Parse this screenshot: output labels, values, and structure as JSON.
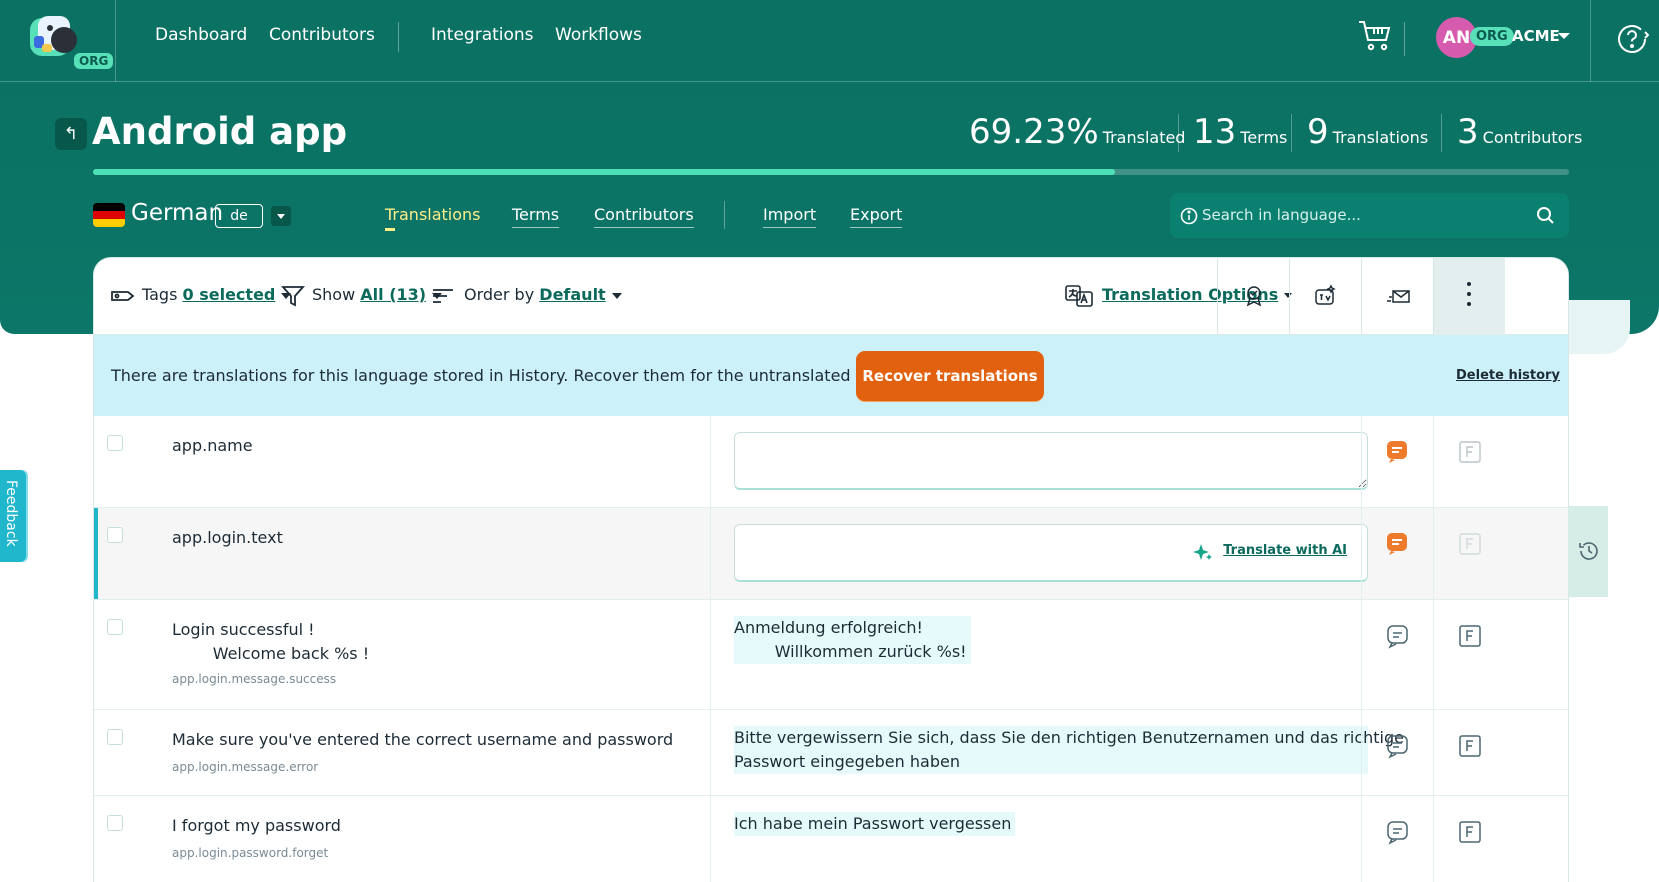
{
  "nav": {
    "org_badge": "ORG",
    "links": [
      "Dashboard",
      "Contributors",
      "Integrations",
      "Workflows"
    ],
    "user_initials": "AN",
    "org_pill": "ORG",
    "org_name": "ACME"
  },
  "project": {
    "title": "Android app",
    "stats": {
      "translated_value": "69.23%",
      "translated_label": "Translated",
      "terms_value": "13",
      "terms_label": "Terms",
      "translations_value": "9",
      "translations_label": "Translations",
      "contributors_value": "3",
      "contributors_label": "Contributors"
    },
    "progress_fraction": 0.6923
  },
  "language": {
    "name": "German",
    "code": "de",
    "flag_colors": [
      "#000000",
      "#dd0000",
      "#ffce00"
    ]
  },
  "subtabs": {
    "translations": "Translations",
    "terms": "Terms",
    "contributors": "Contributors",
    "import": "Import",
    "export": "Export"
  },
  "search": {
    "placeholder": "Search in language..."
  },
  "toolbar": {
    "tags_label": "Tags",
    "tags_value": "0 selected",
    "show_label": "Show",
    "show_value": "All (13)",
    "order_label": "Order by",
    "order_value": "Default",
    "translation_options": "Translation Options"
  },
  "banner": {
    "text": "There are translations for this language stored in History. Recover them for the untranslated strings?",
    "recover_button": "Recover translations",
    "delete_link": "Delete history"
  },
  "rows": [
    {
      "key": "app.name",
      "sub": "",
      "translation": ""
    },
    {
      "key": "app.login.text",
      "sub": "",
      "translation": "",
      "ai_button": "Translate with AI"
    },
    {
      "key": "Login successful !\n        Welcome back %s !",
      "sub": "app.login.message.success",
      "translation": "Anmeldung erfolgreich!\n        Willkommen zurück %s!"
    },
    {
      "key": "Make sure you've entered the correct username and password",
      "sub": "app.login.message.error",
      "translation": "Bitte vergewissern Sie sich, dass Sie den richtigen Benutzernamen und das richtige\nPasswort eingegeben haben"
    },
    {
      "key": "I forgot my password",
      "sub": "app.login.password.forget",
      "translation": "Ich habe mein Passwort vergessen"
    }
  ],
  "feedback_label": "Feedback",
  "colors": {
    "brand_teal": "#0b7263",
    "accent_mint": "#4de0b4",
    "orange": "#e2610e",
    "banner_bg": "#ccf1f8",
    "highlight_bar": "#20b6cc"
  }
}
